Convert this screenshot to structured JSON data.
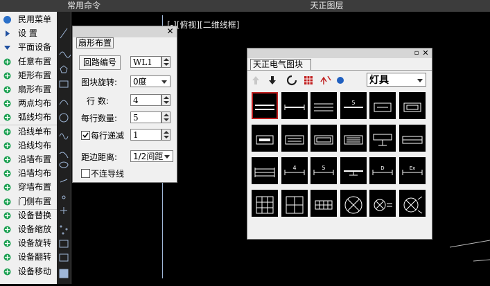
{
  "top_bar": {
    "commands_title": "常用命令",
    "layer_title": "天正图层"
  },
  "left_panel": {
    "items": [
      {
        "label": "民用菜单",
        "icon": "app-logo-icon"
      },
      {
        "label": "设  置",
        "icon": "triangle-right-icon"
      },
      {
        "label": "平面设备",
        "icon": "triangle-down-icon"
      },
      {
        "label": "任意布置",
        "icon": "random-place-icon"
      },
      {
        "label": "矩形布置",
        "icon": "rect-place-icon"
      },
      {
        "label": "扇形布置",
        "icon": "fan-place-icon"
      },
      {
        "label": "两点均布",
        "icon": "two-point-icon"
      },
      {
        "label": "弧线均布",
        "icon": "arc-place-icon"
      },
      {
        "label": "沿线单布",
        "icon": "line-single-icon"
      },
      {
        "label": "沿线均布",
        "icon": "line-even-icon"
      },
      {
        "label": "沿墙布置",
        "icon": "wall-place-icon"
      },
      {
        "label": "沿墙均布",
        "icon": "wall-even-icon"
      },
      {
        "label": "穿墙布置",
        "icon": "through-wall-icon"
      },
      {
        "label": "门侧布置",
        "icon": "door-side-icon"
      },
      {
        "label": "设备替换",
        "icon": "replace-icon"
      },
      {
        "label": "设备缩放",
        "icon": "scale-icon"
      },
      {
        "label": "设备旋转",
        "icon": "rotate-icon"
      },
      {
        "label": "设备翻转",
        "icon": "flip-icon"
      },
      {
        "label": "设备移动",
        "icon": "move-icon"
      }
    ]
  },
  "viewport": {
    "label": "[-][俯视][二维线框]"
  },
  "fan_dialog": {
    "title": "扇形布置",
    "loop_button": "回路编号",
    "loop_value": "WL1",
    "rotate_label": "图块旋转:",
    "rotate_value": "0度",
    "rows_label": "行  数:",
    "rows_value": "4",
    "per_row_label": "每行数量:",
    "per_row_value": "5",
    "decrement_label": "每行递减",
    "decrement_value": "1",
    "margin_label": "距边距离:",
    "margin_value": "1/2间距",
    "no_wire_label": "不连导线"
  },
  "block_dialog": {
    "title": "天正电气图块",
    "category_value": "灯具",
    "cells": [
      "double-line",
      "single-line",
      "triple-line",
      "number-5-line",
      "box-line",
      "double-box",
      "box-bar",
      "box-rect",
      "double-rect",
      "hatched-rect",
      "tee-rect",
      "long-rect",
      "vert-triple",
      "number-4",
      "number-5",
      "wire-bar",
      "d-box",
      "ex-box",
      "grid-3",
      "grid-2",
      "grid-4",
      "circle-x",
      "circle-x-arrow",
      "circle-x-arrows"
    ]
  }
}
